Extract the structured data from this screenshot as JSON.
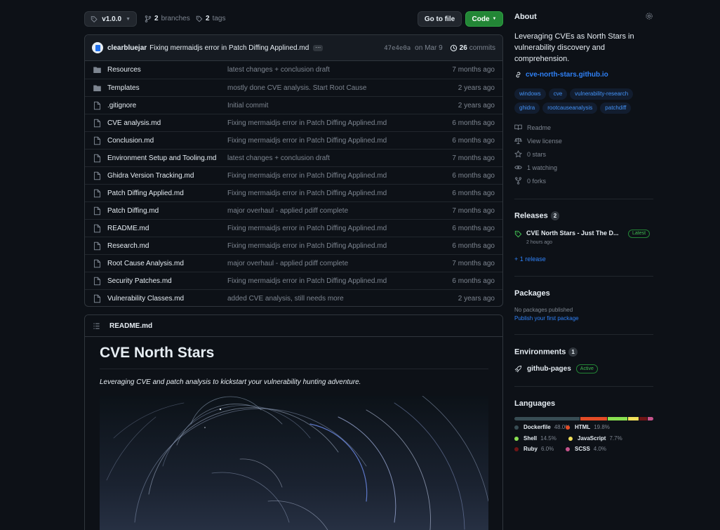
{
  "toolbar": {
    "branch": "v1.0.0",
    "branches_count": "2",
    "branches_label": "branches",
    "tags_count": "2",
    "tags_label": "tags",
    "goto_file": "Go to file",
    "code": "Code"
  },
  "commit": {
    "author": "clearbluejar",
    "message": "Fixing mermaidjs error in Patch Diffing Applined.md",
    "hash": "47e4e0a",
    "date": "on Mar 9",
    "count": "26",
    "count_label": "commits"
  },
  "files": [
    {
      "type": "dir",
      "name": "Resources",
      "message": "latest changes + conclusion draft",
      "age": "7 months ago"
    },
    {
      "type": "dir",
      "name": "Templates",
      "message": "mostly done CVE analysis. Start Root Cause",
      "age": "2 years ago"
    },
    {
      "type": "file",
      "name": ".gitignore",
      "message": "Initial commit",
      "age": "2 years ago"
    },
    {
      "type": "file",
      "name": "CVE analysis.md",
      "message": "Fixing mermaidjs error in Patch Diffing Applined.md",
      "age": "6 months ago"
    },
    {
      "type": "file",
      "name": "Conclusion.md",
      "message": "Fixing mermaidjs error in Patch Diffing Applined.md",
      "age": "6 months ago"
    },
    {
      "type": "file",
      "name": "Environment Setup and Tooling.md",
      "message": "latest changes + conclusion draft",
      "age": "7 months ago"
    },
    {
      "type": "file",
      "name": "Ghidra Version Tracking.md",
      "message": "Fixing mermaidjs error in Patch Diffing Applined.md",
      "age": "6 months ago"
    },
    {
      "type": "file",
      "name": "Patch Diffing Applied.md",
      "message": "Fixing mermaidjs error in Patch Diffing Applined.md",
      "age": "6 months ago"
    },
    {
      "type": "file",
      "name": "Patch Diffing.md",
      "message": "major overhaul - applied pdiff complete",
      "age": "7 months ago"
    },
    {
      "type": "file",
      "name": "README.md",
      "message": "Fixing mermaidjs error in Patch Diffing Applined.md",
      "age": "6 months ago"
    },
    {
      "type": "file",
      "name": "Research.md",
      "message": "Fixing mermaidjs error in Patch Diffing Applined.md",
      "age": "6 months ago"
    },
    {
      "type": "file",
      "name": "Root Cause Analysis.md",
      "message": "major overhaul - applied pdiff complete",
      "age": "7 months ago"
    },
    {
      "type": "file",
      "name": "Security Patches.md",
      "message": "Fixing mermaidjs error in Patch Diffing Applined.md",
      "age": "6 months ago"
    },
    {
      "type": "file",
      "name": "Vulnerability Classes.md",
      "message": "added CVE analysis, still needs more",
      "age": "2 years ago"
    }
  ],
  "readme": {
    "filename": "README.md",
    "title": "CVE North Stars",
    "subtitle": "Leveraging CVE and patch analysis to kickstart your vulnerability hunting adventure."
  },
  "about": {
    "heading": "About",
    "description": "Leveraging CVEs as North Stars in vulnerability discovery and comprehension.",
    "link": "cve-north-stars.github.io",
    "topics": [
      "windows",
      "cve",
      "vulnerability-research",
      "ghidra",
      "rootcauseanalysis",
      "patchdiff"
    ],
    "readme": "Readme",
    "license": "View license",
    "stars": "0 stars",
    "watching": "1 watching",
    "forks": "0 forks"
  },
  "releases": {
    "heading": "Releases",
    "count": "2",
    "name": "CVE North Stars - Just The D...",
    "latest": "Latest",
    "date": "2 hours ago",
    "more": "+ 1 release"
  },
  "packages": {
    "heading": "Packages",
    "none": "No packages published",
    "publish": "Publish your first package"
  },
  "environments": {
    "heading": "Environments",
    "count": "1",
    "name": "github-pages",
    "status": "Active"
  },
  "languages": {
    "heading": "Languages",
    "items": [
      {
        "name": "Dockerfile",
        "percent": "48.0%",
        "value": 48.0,
        "color": "#384d54"
      },
      {
        "name": "HTML",
        "percent": "19.8%",
        "value": 19.8,
        "color": "#e34c26"
      },
      {
        "name": "Shell",
        "percent": "14.5%",
        "value": 14.5,
        "color": "#89e051"
      },
      {
        "name": "JavaScript",
        "percent": "7.7%",
        "value": 7.7,
        "color": "#f1e05a"
      },
      {
        "name": "Ruby",
        "percent": "6.0%",
        "value": 6.0,
        "color": "#701516"
      },
      {
        "name": "SCSS",
        "percent": "4.0%",
        "value": 4.0,
        "color": "#c6538c"
      }
    ]
  }
}
